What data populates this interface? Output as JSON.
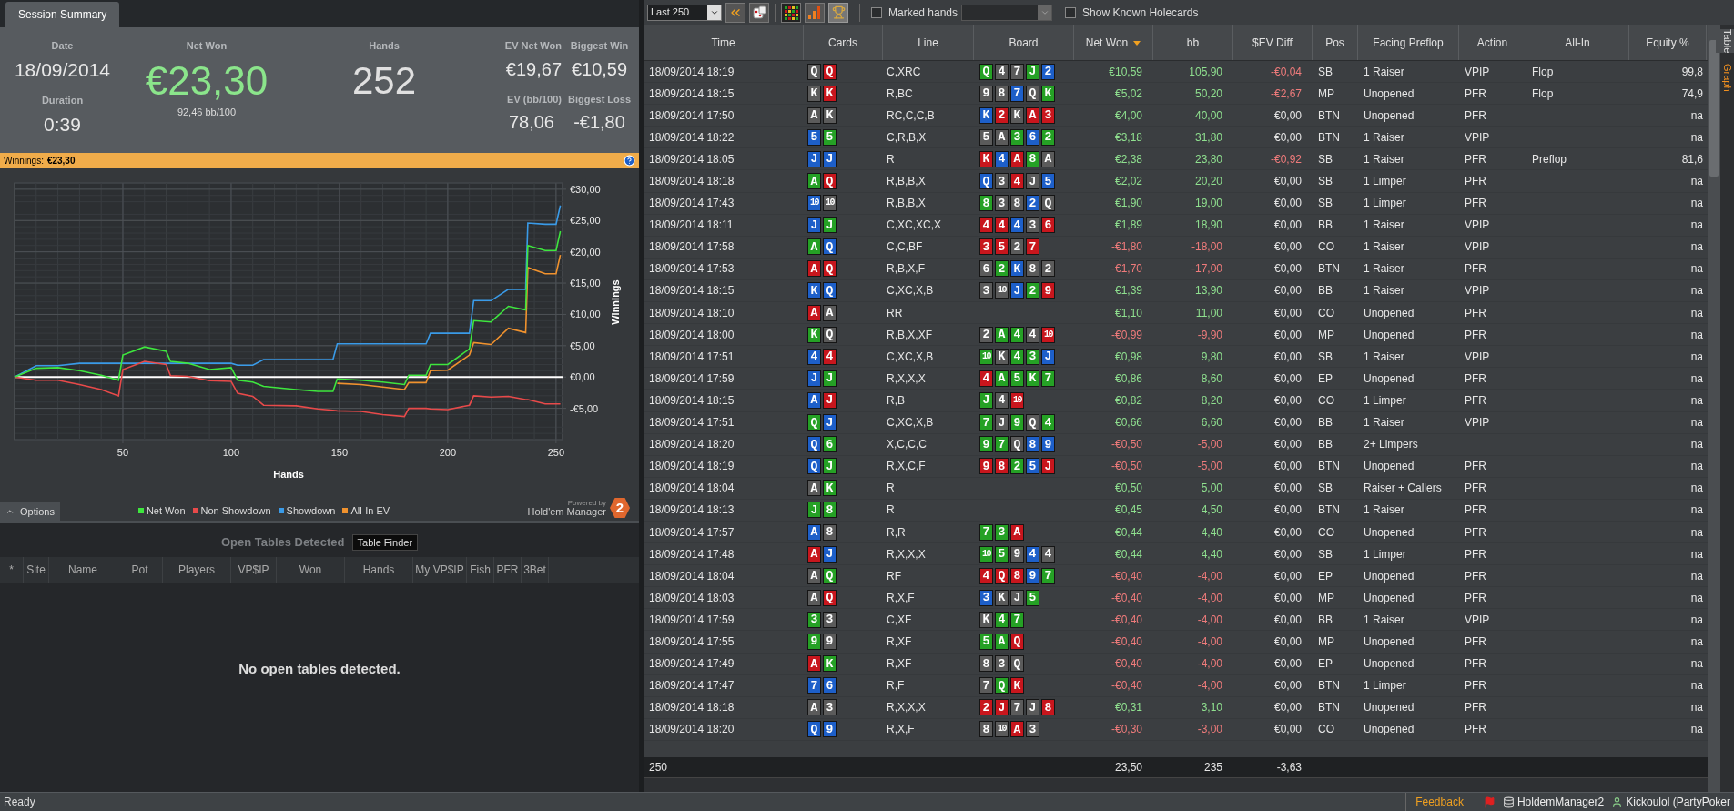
{
  "left_tabs": [
    {
      "label": "Session Summary",
      "selected": true
    }
  ],
  "summary": {
    "date_label": "Date",
    "date": "18/09/2014",
    "duration_label": "Duration",
    "duration": "0:39",
    "net_won_label": "Net Won",
    "net_won": "€23,30",
    "bb100": "92,46 bb/100",
    "hands_label": "Hands",
    "hands": "252",
    "ev_net_won_label": "EV Net Won",
    "ev_net_won": "€19,67",
    "ev_bb_label": "EV (bb/100)",
    "ev_bb": "78,06",
    "biggest_win_label": "Biggest Win",
    "biggest_win": "€10,59",
    "biggest_loss_label": "Biggest Loss",
    "biggest_loss": "-€1,80"
  },
  "winnings_bar": {
    "label": "Winnings:",
    "value": "€23,30"
  },
  "graph": {
    "chart_data": {
      "type": "line",
      "grid": true,
      "xlabel": "Hands",
      "ylabel": "Winnings",
      "xlim": [
        0,
        253
      ],
      "ylim": [
        -10,
        31
      ],
      "xticks": [
        50,
        100,
        150,
        200,
        250
      ],
      "yticks": [
        {
          "value": -5,
          "label": "-€5,00"
        },
        {
          "value": 0,
          "label": "€0,00"
        },
        {
          "value": 5,
          "label": "€5,00"
        },
        {
          "value": 10,
          "label": "€10,00"
        },
        {
          "value": 15,
          "label": "€15,00"
        },
        {
          "value": 20,
          "label": "€20,00"
        },
        {
          "value": 25,
          "label": "€25,00"
        },
        {
          "value": 30,
          "label": "€30,00"
        }
      ],
      "x": [
        0,
        10,
        20,
        30,
        40,
        48,
        50,
        60,
        70,
        72,
        80,
        90,
        100,
        103,
        110,
        115,
        130,
        140,
        147,
        149,
        160,
        170,
        180,
        182,
        190,
        192,
        200,
        210,
        212,
        220,
        228,
        236,
        237,
        245,
        250,
        252
      ],
      "series": [
        {
          "name": "Net Won",
          "color": "#3ee63e",
          "values": [
            0,
            1.4,
            1.5,
            1.0,
            0.3,
            -0.5,
            3.5,
            4.8,
            4.1,
            2.5,
            2.2,
            1.2,
            1.5,
            -0.5,
            -0.8,
            -1.5,
            -2.0,
            -2.3,
            -2.3,
            -0.3,
            -0.5,
            -0.8,
            -1.2,
            0.3,
            0.3,
            2.0,
            2.0,
            4.5,
            9.0,
            8.8,
            11.3,
            10.7,
            21.0,
            20.2,
            20.2,
            23.3
          ]
        },
        {
          "name": "Non Showdown",
          "color": "#e84a4a",
          "values": [
            0,
            -0.5,
            -0.5,
            -1.2,
            -2.0,
            -3.0,
            1.2,
            2.5,
            2.0,
            0.2,
            0.1,
            -0.6,
            -0.7,
            -2.6,
            -3.1,
            -4.5,
            -4.6,
            -5.1,
            -5.3,
            -5.4,
            -5.5,
            -6.0,
            -6.3,
            -5.0,
            -5.0,
            -5.1,
            -5.2,
            -4.5,
            -3.0,
            -3.2,
            -3.1,
            -3.6,
            -3.6,
            -4.3,
            -4.3,
            -4.3
          ]
        },
        {
          "name": "Showdown",
          "color": "#3a9be8",
          "values": [
            0,
            1.8,
            1.8,
            2.2,
            2.2,
            2.2,
            2.2,
            2.2,
            2.2,
            2.2,
            2.2,
            2.2,
            2.2,
            1.9,
            1.9,
            2.8,
            2.8,
            2.8,
            2.8,
            5.3,
            5.3,
            5.3,
            5.3,
            5.3,
            5.3,
            7.0,
            7.0,
            7.0,
            12.2,
            12.2,
            14.0,
            14.0,
            24.6,
            24.4,
            24.4,
            27.4
          ]
        },
        {
          "name": "All-In EV",
          "color": "#f0922e",
          "values": [
            null,
            null,
            null,
            null,
            null,
            null,
            null,
            null,
            null,
            null,
            null,
            null,
            null,
            null,
            null,
            null,
            null,
            null,
            null,
            -1.0,
            -1.2,
            -1.6,
            -2.0,
            -0.9,
            -0.9,
            1.0,
            1.1,
            3.5,
            5.5,
            5.2,
            7.8,
            7.1,
            17.5,
            16.5,
            16.5,
            19.5
          ]
        }
      ]
    },
    "options_button": "Options",
    "powered_by": "Powered by",
    "brand": "Hold'em Manager",
    "brand_badge": "2"
  },
  "open_tables": {
    "title": "Open Tables Detected",
    "finder_button": "Table Finder",
    "columns": [
      "*",
      "Site",
      "Name",
      "Pot",
      "Players",
      "VP$IP",
      "Won",
      "Hands",
      "My VP$IP",
      "Fish",
      "PFR",
      "3Bet"
    ],
    "empty_message": "No open tables detected."
  },
  "toolbar": {
    "range": "Last 250",
    "marked_hands": {
      "label": "Marked hands",
      "checked": false
    },
    "show_holecards": {
      "label": "Show Known Holecards",
      "checked": false
    }
  },
  "table": {
    "columns": [
      {
        "label": "Time",
        "sorted": false
      },
      {
        "label": "Cards",
        "sorted": false
      },
      {
        "label": "Line",
        "sorted": false
      },
      {
        "label": "Board",
        "sorted": false
      },
      {
        "label": "Net Won",
        "sorted": true
      },
      {
        "label": "bb",
        "sorted": false
      },
      {
        "label": "$EV Diff",
        "sorted": false
      },
      {
        "label": "Pos",
        "sorted": false
      },
      {
        "label": "Facing Preflop",
        "sorted": false
      },
      {
        "label": "Action",
        "sorted": false
      },
      {
        "label": "All-In",
        "sorted": false
      },
      {
        "label": "Equity %",
        "sorted": false
      }
    ],
    "rows": [
      {
        "time": "18/09/2014 18:19",
        "cards": [
          {
            "rank": "Q",
            "color": "#5b5b5b"
          },
          {
            "rank": "Q",
            "color": "#c8161d"
          }
        ],
        "line": "C,XRC",
        "board": [
          {
            "rank": "Q",
            "color": "#25a125"
          },
          {
            "rank": "4",
            "color": "#5b5b5b"
          },
          {
            "rank": "7",
            "color": "#5b5b5b"
          },
          {
            "rank": "J",
            "color": "#25a125"
          },
          {
            "rank": "2",
            "color": "#1d5fc9"
          }
        ],
        "net_won": "€10,59",
        "bb": "105,90",
        "ev_diff": "-€0,04",
        "pos": "SB",
        "facing": "1 Raiser",
        "action": "VPIP",
        "all_in": "Flop",
        "equity": "99,8",
        "loss": false,
        "ev_loss": true
      },
      {
        "time": "18/09/2014 18:15",
        "cards": [
          {
            "rank": "K",
            "color": "#5b5b5b"
          },
          {
            "rank": "K",
            "color": "#c8161d"
          }
        ],
        "line": "R,BC",
        "board": [
          {
            "rank": "9",
            "color": "#5b5b5b"
          },
          {
            "rank": "8",
            "color": "#5b5b5b"
          },
          {
            "rank": "7",
            "color": "#1d5fc9"
          },
          {
            "rank": "Q",
            "color": "#5b5b5b"
          },
          {
            "rank": "K",
            "color": "#25a125"
          }
        ],
        "net_won": "€5,02",
        "bb": "50,20",
        "ev_diff": "-€2,67",
        "pos": "MP",
        "facing": "Unopened",
        "action": "PFR",
        "all_in": "Flop",
        "equity": "74,9",
        "loss": false,
        "ev_loss": true
      },
      {
        "time": "18/09/2014 17:50",
        "cards": [
          {
            "rank": "A",
            "color": "#5b5b5b"
          },
          {
            "rank": "K",
            "color": "#5b5b5b"
          }
        ],
        "line": "RC,C,C,B",
        "board": [
          {
            "rank": "K",
            "color": "#1d5fc9"
          },
          {
            "rank": "2",
            "color": "#c8161d"
          },
          {
            "rank": "K",
            "color": "#5b5b5b"
          },
          {
            "rank": "A",
            "color": "#c8161d"
          },
          {
            "rank": "3",
            "color": "#c8161d"
          }
        ],
        "net_won": "€4,00",
        "bb": "40,00",
        "ev_diff": "€0,00",
        "pos": "BTN",
        "facing": "Unopened",
        "action": "PFR",
        "equity": "na",
        "loss": false,
        "ev_loss": false
      },
      {
        "time": "18/09/2014 18:22",
        "cards": [
          {
            "rank": "5",
            "color": "#1d5fc9"
          },
          {
            "rank": "5",
            "color": "#25a125"
          }
        ],
        "line": "C,R,B,X",
        "board": [
          {
            "rank": "5",
            "color": "#5b5b5b"
          },
          {
            "rank": "A",
            "color": "#5b5b5b"
          },
          {
            "rank": "3",
            "color": "#25a125"
          },
          {
            "rank": "6",
            "color": "#1d5fc9"
          },
          {
            "rank": "2",
            "color": "#25a125"
          }
        ],
        "net_won": "€3,18",
        "bb": "31,80",
        "ev_diff": "€0,00",
        "pos": "BTN",
        "facing": "1 Raiser",
        "action": "VPIP",
        "equity": "na",
        "loss": false,
        "ev_loss": false
      },
      {
        "time": "18/09/2014 18:05",
        "cards": [
          {
            "rank": "J",
            "color": "#1d5fc9"
          },
          {
            "rank": "J",
            "color": "#1d5fc9"
          }
        ],
        "line": "R",
        "board": [
          {
            "rank": "K",
            "color": "#c8161d"
          },
          {
            "rank": "4",
            "color": "#1d5fc9"
          },
          {
            "rank": "A",
            "color": "#c8161d"
          },
          {
            "rank": "8",
            "color": "#25a125"
          },
          {
            "rank": "A",
            "color": "#5b5b5b"
          }
        ],
        "net_won": "€2,38",
        "bb": "23,80",
        "ev_diff": "-€0,92",
        "pos": "SB",
        "facing": "1 Raiser",
        "action": "PFR",
        "all_in": "Preflop",
        "equity": "81,6",
        "loss": false,
        "ev_loss": true
      },
      {
        "time": "18/09/2014 18:18",
        "cards": [
          {
            "rank": "A",
            "color": "#25a125"
          },
          {
            "rank": "Q",
            "color": "#c8161d"
          }
        ],
        "line": "R,B,B,X",
        "board": [
          {
            "rank": "Q",
            "color": "#1d5fc9"
          },
          {
            "rank": "3",
            "color": "#5b5b5b"
          },
          {
            "rank": "4",
            "color": "#c8161d"
          },
          {
            "rank": "J",
            "color": "#5b5b5b"
          },
          {
            "rank": "5",
            "color": "#1d5fc9"
          }
        ],
        "net_won": "€2,02",
        "bb": "20,20",
        "ev_diff": "€0,00",
        "pos": "SB",
        "facing": "1 Limper",
        "action": "PFR",
        "equity": "na",
        "loss": false,
        "ev_loss": false
      },
      {
        "time": "18/09/2014 17:43",
        "cards": [
          {
            "rank": "10",
            "color": "#1d5fc9"
          },
          {
            "rank": "10",
            "color": "#5b5b5b"
          }
        ],
        "line": "R,B,B,X",
        "board": [
          {
            "rank": "8",
            "color": "#25a125"
          },
          {
            "rank": "3",
            "color": "#5b5b5b"
          },
          {
            "rank": "8",
            "color": "#5b5b5b"
          },
          {
            "rank": "2",
            "color": "#1d5fc9"
          },
          {
            "rank": "Q",
            "color": "#5b5b5b"
          }
        ],
        "net_won": "€1,90",
        "bb": "19,00",
        "ev_diff": "€0,00",
        "pos": "SB",
        "facing": "1 Limper",
        "action": "PFR",
        "equity": "na",
        "loss": false,
        "ev_loss": false
      },
      {
        "time": "18/09/2014 18:11",
        "cards": [
          {
            "rank": "J",
            "color": "#1d5fc9"
          },
          {
            "rank": "J",
            "color": "#25a125"
          }
        ],
        "line": "C,XC,XC,X",
        "board": [
          {
            "rank": "4",
            "color": "#c8161d"
          },
          {
            "rank": "4",
            "color": "#c8161d"
          },
          {
            "rank": "4",
            "color": "#1d5fc9"
          },
          {
            "rank": "3",
            "color": "#5b5b5b"
          },
          {
            "rank": "6",
            "color": "#c8161d"
          }
        ],
        "net_won": "€1,89",
        "bb": "18,90",
        "ev_diff": "€0,00",
        "pos": "BB",
        "facing": "1 Raiser",
        "action": "VPIP",
        "equity": "na",
        "loss": false,
        "ev_loss": false
      },
      {
        "time": "18/09/2014 17:58",
        "cards": [
          {
            "rank": "A",
            "color": "#25a125"
          },
          {
            "rank": "Q",
            "color": "#1d5fc9"
          }
        ],
        "line": "C,C,BF",
        "board": [
          {
            "rank": "3",
            "color": "#c8161d"
          },
          {
            "rank": "5",
            "color": "#c8161d"
          },
          {
            "rank": "2",
            "color": "#5b5b5b"
          },
          {
            "rank": "7",
            "color": "#c8161d"
          }
        ],
        "net_won": "-€1,80",
        "bb": "-18,00",
        "ev_diff": "€0,00",
        "pos": "CO",
        "facing": "1 Raiser",
        "action": "VPIP",
        "equity": "na",
        "loss": true,
        "ev_loss": false
      },
      {
        "time": "18/09/2014 17:53",
        "cards": [
          {
            "rank": "A",
            "color": "#c8161d"
          },
          {
            "rank": "Q",
            "color": "#c8161d"
          }
        ],
        "line": "R,B,X,F",
        "board": [
          {
            "rank": "6",
            "color": "#5b5b5b"
          },
          {
            "rank": "2",
            "color": "#25a125"
          },
          {
            "rank": "K",
            "color": "#1d5fc9"
          },
          {
            "rank": "8",
            "color": "#5b5b5b"
          },
          {
            "rank": "2",
            "color": "#5b5b5b"
          }
        ],
        "net_won": "-€1,70",
        "bb": "-17,00",
        "ev_diff": "€0,00",
        "pos": "BTN",
        "facing": "1 Raiser",
        "action": "PFR",
        "equity": "na",
        "loss": true,
        "ev_loss": false
      },
      {
        "time": "18/09/2014 18:15",
        "cards": [
          {
            "rank": "K",
            "color": "#1d5fc9"
          },
          {
            "rank": "Q",
            "color": "#1d5fc9"
          }
        ],
        "line": "C,XC,X,B",
        "board": [
          {
            "rank": "3",
            "color": "#5b5b5b"
          },
          {
            "rank": "10",
            "color": "#5b5b5b"
          },
          {
            "rank": "J",
            "color": "#1d5fc9"
          },
          {
            "rank": "2",
            "color": "#25a125"
          },
          {
            "rank": "9",
            "color": "#c8161d"
          }
        ],
        "net_won": "€1,39",
        "bb": "13,90",
        "ev_diff": "€0,00",
        "pos": "BB",
        "facing": "1 Raiser",
        "action": "VPIP",
        "equity": "na",
        "loss": false,
        "ev_loss": false
      },
      {
        "time": "18/09/2014 18:10",
        "cards": [
          {
            "rank": "A",
            "color": "#c8161d"
          },
          {
            "rank": "A",
            "color": "#5b5b5b"
          }
        ],
        "line": "RR",
        "board": [],
        "net_won": "€1,10",
        "bb": "11,00",
        "ev_diff": "€0,00",
        "pos": "CO",
        "facing": "Unopened",
        "action": "PFR",
        "equity": "na",
        "loss": false,
        "ev_loss": false
      },
      {
        "time": "18/09/2014 18:00",
        "cards": [
          {
            "rank": "K",
            "color": "#25a125"
          },
          {
            "rank": "Q",
            "color": "#5b5b5b"
          }
        ],
        "line": "R,B,X,XF",
        "board": [
          {
            "rank": "2",
            "color": "#5b5b5b"
          },
          {
            "rank": "A",
            "color": "#25a125"
          },
          {
            "rank": "4",
            "color": "#25a125"
          },
          {
            "rank": "4",
            "color": "#5b5b5b"
          },
          {
            "rank": "10",
            "color": "#c8161d"
          }
        ],
        "net_won": "-€0,99",
        "bb": "-9,90",
        "ev_diff": "€0,00",
        "pos": "MP",
        "facing": "Unopened",
        "action": "PFR",
        "equity": "na",
        "loss": true,
        "ev_loss": false
      },
      {
        "time": "18/09/2014 17:51",
        "cards": [
          {
            "rank": "4",
            "color": "#1d5fc9"
          },
          {
            "rank": "4",
            "color": "#c8161d"
          }
        ],
        "line": "C,XC,X,B",
        "board": [
          {
            "rank": "10",
            "color": "#25a125"
          },
          {
            "rank": "K",
            "color": "#5b5b5b"
          },
          {
            "rank": "4",
            "color": "#25a125"
          },
          {
            "rank": "3",
            "color": "#25a125"
          },
          {
            "rank": "J",
            "color": "#1d5fc9"
          }
        ],
        "net_won": "€0,98",
        "bb": "9,80",
        "ev_diff": "€0,00",
        "pos": "SB",
        "facing": "1 Raiser",
        "action": "VPIP",
        "equity": "na",
        "loss": false,
        "ev_loss": false
      },
      {
        "time": "18/09/2014 17:59",
        "cards": [
          {
            "rank": "J",
            "color": "#1d5fc9"
          },
          {
            "rank": "J",
            "color": "#25a125"
          }
        ],
        "line": "R,X,X,X",
        "board": [
          {
            "rank": "4",
            "color": "#c8161d"
          },
          {
            "rank": "A",
            "color": "#25a125"
          },
          {
            "rank": "5",
            "color": "#25a125"
          },
          {
            "rank": "K",
            "color": "#25a125"
          },
          {
            "rank": "7",
            "color": "#25a125"
          }
        ],
        "net_won": "€0,86",
        "bb": "8,60",
        "ev_diff": "€0,00",
        "pos": "EP",
        "facing": "Unopened",
        "action": "PFR",
        "equity": "na",
        "loss": false,
        "ev_loss": false
      },
      {
        "time": "18/09/2014 18:15",
        "cards": [
          {
            "rank": "A",
            "color": "#1d5fc9"
          },
          {
            "rank": "J",
            "color": "#c8161d"
          }
        ],
        "line": "R,B",
        "board": [
          {
            "rank": "J",
            "color": "#25a125"
          },
          {
            "rank": "4",
            "color": "#5b5b5b"
          },
          {
            "rank": "10",
            "color": "#c8161d"
          }
        ],
        "net_won": "€0,82",
        "bb": "8,20",
        "ev_diff": "€0,00",
        "pos": "CO",
        "facing": "1 Limper",
        "action": "PFR",
        "equity": "na",
        "loss": false,
        "ev_loss": false
      },
      {
        "time": "18/09/2014 17:51",
        "cards": [
          {
            "rank": "Q",
            "color": "#25a125"
          },
          {
            "rank": "J",
            "color": "#1d5fc9"
          }
        ],
        "line": "C,XC,X,B",
        "board": [
          {
            "rank": "7",
            "color": "#25a125"
          },
          {
            "rank": "J",
            "color": "#5b5b5b"
          },
          {
            "rank": "9",
            "color": "#25a125"
          },
          {
            "rank": "Q",
            "color": "#5b5b5b"
          },
          {
            "rank": "4",
            "color": "#25a125"
          }
        ],
        "net_won": "€0,66",
        "bb": "6,60",
        "ev_diff": "€0,00",
        "pos": "BB",
        "facing": "1 Raiser",
        "action": "VPIP",
        "equity": "na",
        "loss": false,
        "ev_loss": false
      },
      {
        "time": "18/09/2014 18:20",
        "cards": [
          {
            "rank": "Q",
            "color": "#1d5fc9"
          },
          {
            "rank": "6",
            "color": "#25a125"
          }
        ],
        "line": "X,C,C,C",
        "board": [
          {
            "rank": "9",
            "color": "#25a125"
          },
          {
            "rank": "7",
            "color": "#25a125"
          },
          {
            "rank": "Q",
            "color": "#5b5b5b"
          },
          {
            "rank": "8",
            "color": "#1d5fc9"
          },
          {
            "rank": "9",
            "color": "#1d5fc9"
          }
        ],
        "net_won": "-€0,50",
        "bb": "-5,00",
        "ev_diff": "€0,00",
        "pos": "BB",
        "facing": "2+ Limpers",
        "equity": "na",
        "loss": true,
        "ev_loss": false
      },
      {
        "time": "18/09/2014 18:19",
        "cards": [
          {
            "rank": "Q",
            "color": "#1d5fc9"
          },
          {
            "rank": "J",
            "color": "#25a125"
          }
        ],
        "line": "R,X,C,F",
        "board": [
          {
            "rank": "9",
            "color": "#c8161d"
          },
          {
            "rank": "8",
            "color": "#c8161d"
          },
          {
            "rank": "2",
            "color": "#25a125"
          },
          {
            "rank": "5",
            "color": "#1d5fc9"
          },
          {
            "rank": "J",
            "color": "#c8161d"
          }
        ],
        "net_won": "-€0,50",
        "bb": "-5,00",
        "ev_diff": "€0,00",
        "pos": "BTN",
        "facing": "Unopened",
        "action": "PFR",
        "equity": "na",
        "loss": true,
        "ev_loss": false
      },
      {
        "time": "18/09/2014 18:04",
        "cards": [
          {
            "rank": "A",
            "color": "#5b5b5b"
          },
          {
            "rank": "K",
            "color": "#25a125"
          }
        ],
        "line": "R",
        "board": [],
        "net_won": "€0,50",
        "bb": "5,00",
        "ev_diff": "€0,00",
        "pos": "SB",
        "facing": "Raiser + Callers",
        "action": "PFR",
        "equity": "na",
        "loss": false,
        "ev_loss": false
      },
      {
        "time": "18/09/2014 18:13",
        "cards": [
          {
            "rank": "J",
            "color": "#25a125"
          },
          {
            "rank": "8",
            "color": "#25a125"
          }
        ],
        "line": "R",
        "board": [],
        "net_won": "€0,45",
        "bb": "4,50",
        "ev_diff": "€0,00",
        "pos": "BTN",
        "facing": "1 Raiser",
        "action": "PFR",
        "equity": "na",
        "loss": false,
        "ev_loss": false
      },
      {
        "time": "18/09/2014 17:57",
        "cards": [
          {
            "rank": "A",
            "color": "#1d5fc9"
          },
          {
            "rank": "8",
            "color": "#5b5b5b"
          }
        ],
        "line": "R,R",
        "board": [
          {
            "rank": "7",
            "color": "#25a125"
          },
          {
            "rank": "3",
            "color": "#25a125"
          },
          {
            "rank": "A",
            "color": "#c8161d"
          }
        ],
        "net_won": "€0,44",
        "bb": "4,40",
        "ev_diff": "€0,00",
        "pos": "CO",
        "facing": "Unopened",
        "action": "PFR",
        "equity": "na",
        "loss": false,
        "ev_loss": false
      },
      {
        "time": "18/09/2014 17:48",
        "cards": [
          {
            "rank": "A",
            "color": "#c8161d"
          },
          {
            "rank": "J",
            "color": "#1d5fc9"
          }
        ],
        "line": "R,X,X,X",
        "board": [
          {
            "rank": "10",
            "color": "#25a125"
          },
          {
            "rank": "5",
            "color": "#25a125"
          },
          {
            "rank": "9",
            "color": "#5b5b5b"
          },
          {
            "rank": "4",
            "color": "#1d5fc9"
          },
          {
            "rank": "4",
            "color": "#5b5b5b"
          }
        ],
        "net_won": "€0,44",
        "bb": "4,40",
        "ev_diff": "€0,00",
        "pos": "SB",
        "facing": "1 Limper",
        "action": "PFR",
        "equity": "na",
        "loss": false,
        "ev_loss": false
      },
      {
        "time": "18/09/2014 18:04",
        "cards": [
          {
            "rank": "A",
            "color": "#5b5b5b"
          },
          {
            "rank": "Q",
            "color": "#25a125"
          }
        ],
        "line": "RF",
        "board": [
          {
            "rank": "4",
            "color": "#c8161d"
          },
          {
            "rank": "Q",
            "color": "#c8161d"
          },
          {
            "rank": "8",
            "color": "#c8161d"
          },
          {
            "rank": "9",
            "color": "#1d5fc9"
          },
          {
            "rank": "7",
            "color": "#25a125"
          }
        ],
        "net_won": "-€0,40",
        "bb": "-4,00",
        "ev_diff": "€0,00",
        "pos": "EP",
        "facing": "Unopened",
        "action": "PFR",
        "equity": "na",
        "loss": true,
        "ev_loss": false
      },
      {
        "time": "18/09/2014 18:03",
        "cards": [
          {
            "rank": "A",
            "color": "#5b5b5b"
          },
          {
            "rank": "Q",
            "color": "#c8161d"
          }
        ],
        "line": "R,X,F",
        "board": [
          {
            "rank": "3",
            "color": "#1d5fc9"
          },
          {
            "rank": "K",
            "color": "#5b5b5b"
          },
          {
            "rank": "J",
            "color": "#5b5b5b"
          },
          {
            "rank": "5",
            "color": "#25a125"
          }
        ],
        "net_won": "-€0,40",
        "bb": "-4,00",
        "ev_diff": "€0,00",
        "pos": "MP",
        "facing": "Unopened",
        "action": "PFR",
        "equity": "na",
        "loss": true,
        "ev_loss": false
      },
      {
        "time": "18/09/2014 17:59",
        "cards": [
          {
            "rank": "3",
            "color": "#25a125"
          },
          {
            "rank": "3",
            "color": "#5b5b5b"
          }
        ],
        "line": "C,XF",
        "board": [
          {
            "rank": "K",
            "color": "#5b5b5b"
          },
          {
            "rank": "4",
            "color": "#25a125"
          },
          {
            "rank": "7",
            "color": "#25a125"
          }
        ],
        "net_won": "-€0,40",
        "bb": "-4,00",
        "ev_diff": "€0,00",
        "pos": "BB",
        "facing": "1 Raiser",
        "action": "VPIP",
        "equity": "na",
        "loss": true,
        "ev_loss": false
      },
      {
        "time": "18/09/2014 17:55",
        "cards": [
          {
            "rank": "9",
            "color": "#25a125"
          },
          {
            "rank": "9",
            "color": "#5b5b5b"
          }
        ],
        "line": "R,XF",
        "board": [
          {
            "rank": "5",
            "color": "#25a125"
          },
          {
            "rank": "A",
            "color": "#25a125"
          },
          {
            "rank": "Q",
            "color": "#c8161d"
          }
        ],
        "net_won": "-€0,40",
        "bb": "-4,00",
        "ev_diff": "€0,00",
        "pos": "MP",
        "facing": "Unopened",
        "action": "PFR",
        "equity": "na",
        "loss": true,
        "ev_loss": false
      },
      {
        "time": "18/09/2014 17:49",
        "cards": [
          {
            "rank": "A",
            "color": "#c8161d"
          },
          {
            "rank": "K",
            "color": "#25a125"
          }
        ],
        "line": "R,XF",
        "board": [
          {
            "rank": "8",
            "color": "#5b5b5b"
          },
          {
            "rank": "3",
            "color": "#5b5b5b"
          },
          {
            "rank": "Q",
            "color": "#5b5b5b"
          }
        ],
        "net_won": "-€0,40",
        "bb": "-4,00",
        "ev_diff": "€0,00",
        "pos": "EP",
        "facing": "Unopened",
        "action": "PFR",
        "equity": "na",
        "loss": true,
        "ev_loss": false
      },
      {
        "time": "18/09/2014 17:47",
        "cards": [
          {
            "rank": "7",
            "color": "#1d5fc9"
          },
          {
            "rank": "6",
            "color": "#1d5fc9"
          }
        ],
        "line": "R,F",
        "board": [
          {
            "rank": "7",
            "color": "#5b5b5b"
          },
          {
            "rank": "Q",
            "color": "#25a125"
          },
          {
            "rank": "K",
            "color": "#c8161d"
          }
        ],
        "net_won": "-€0,40",
        "bb": "-4,00",
        "ev_diff": "€0,00",
        "pos": "BTN",
        "facing": "1 Limper",
        "action": "PFR",
        "equity": "na",
        "loss": true,
        "ev_loss": false
      },
      {
        "time": "18/09/2014 18:18",
        "cards": [
          {
            "rank": "A",
            "color": "#5b5b5b"
          },
          {
            "rank": "3",
            "color": "#5b5b5b"
          }
        ],
        "line": "R,X,X,X",
        "board": [
          {
            "rank": "2",
            "color": "#c8161d"
          },
          {
            "rank": "J",
            "color": "#c8161d"
          },
          {
            "rank": "7",
            "color": "#5b5b5b"
          },
          {
            "rank": "J",
            "color": "#5b5b5b"
          },
          {
            "rank": "8",
            "color": "#c8161d"
          }
        ],
        "net_won": "€0,31",
        "bb": "3,10",
        "ev_diff": "€0,00",
        "pos": "BTN",
        "facing": "Unopened",
        "action": "PFR",
        "equity": "na",
        "loss": false,
        "ev_loss": false
      },
      {
        "time": "18/09/2014 18:20",
        "cards": [
          {
            "rank": "Q",
            "color": "#1d5fc9"
          },
          {
            "rank": "9",
            "color": "#1d5fc9"
          }
        ],
        "line": "R,X,F",
        "board": [
          {
            "rank": "8",
            "color": "#5b5b5b"
          },
          {
            "rank": "10",
            "color": "#5b5b5b"
          },
          {
            "rank": "A",
            "color": "#c8161d"
          },
          {
            "rank": "3",
            "color": "#5b5b5b"
          }
        ],
        "net_won": "-€0,30",
        "bb": "-3,00",
        "ev_diff": "€0,00",
        "pos": "CO",
        "facing": "Unopened",
        "action": "PFR",
        "equity": "na",
        "loss": true,
        "ev_loss": false
      }
    ],
    "footer": {
      "count": "250",
      "net_won": "23,50",
      "bb": "235",
      "ev_diff": "-3,63"
    }
  },
  "side_tabs": [
    {
      "label": "Table",
      "selected": true
    },
    {
      "label": "Graph",
      "selected": false
    }
  ],
  "status_bar": {
    "text": "Ready",
    "feedback": "Feedback",
    "app": "HoldemManager2",
    "user": "Kickoulol (PartyPoker"
  }
}
